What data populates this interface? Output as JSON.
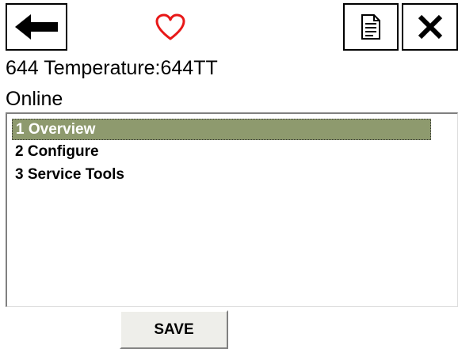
{
  "toolbar": {
    "back_icon": "arrow-left-icon",
    "status_icon": "heart-outline-icon",
    "document_icon": "document-icon",
    "close_icon": "close-x-icon",
    "heart_color": "#e81818"
  },
  "device": {
    "title": "644 Temperature:644TT",
    "status": "Online"
  },
  "menu": {
    "selected_color": "#8e9a6e",
    "items": [
      {
        "label": "1 Overview",
        "selected": true
      },
      {
        "label": "2 Configure",
        "selected": false
      },
      {
        "label": "3 Service Tools",
        "selected": false
      }
    ]
  },
  "footer": {
    "save_label": "SAVE"
  }
}
